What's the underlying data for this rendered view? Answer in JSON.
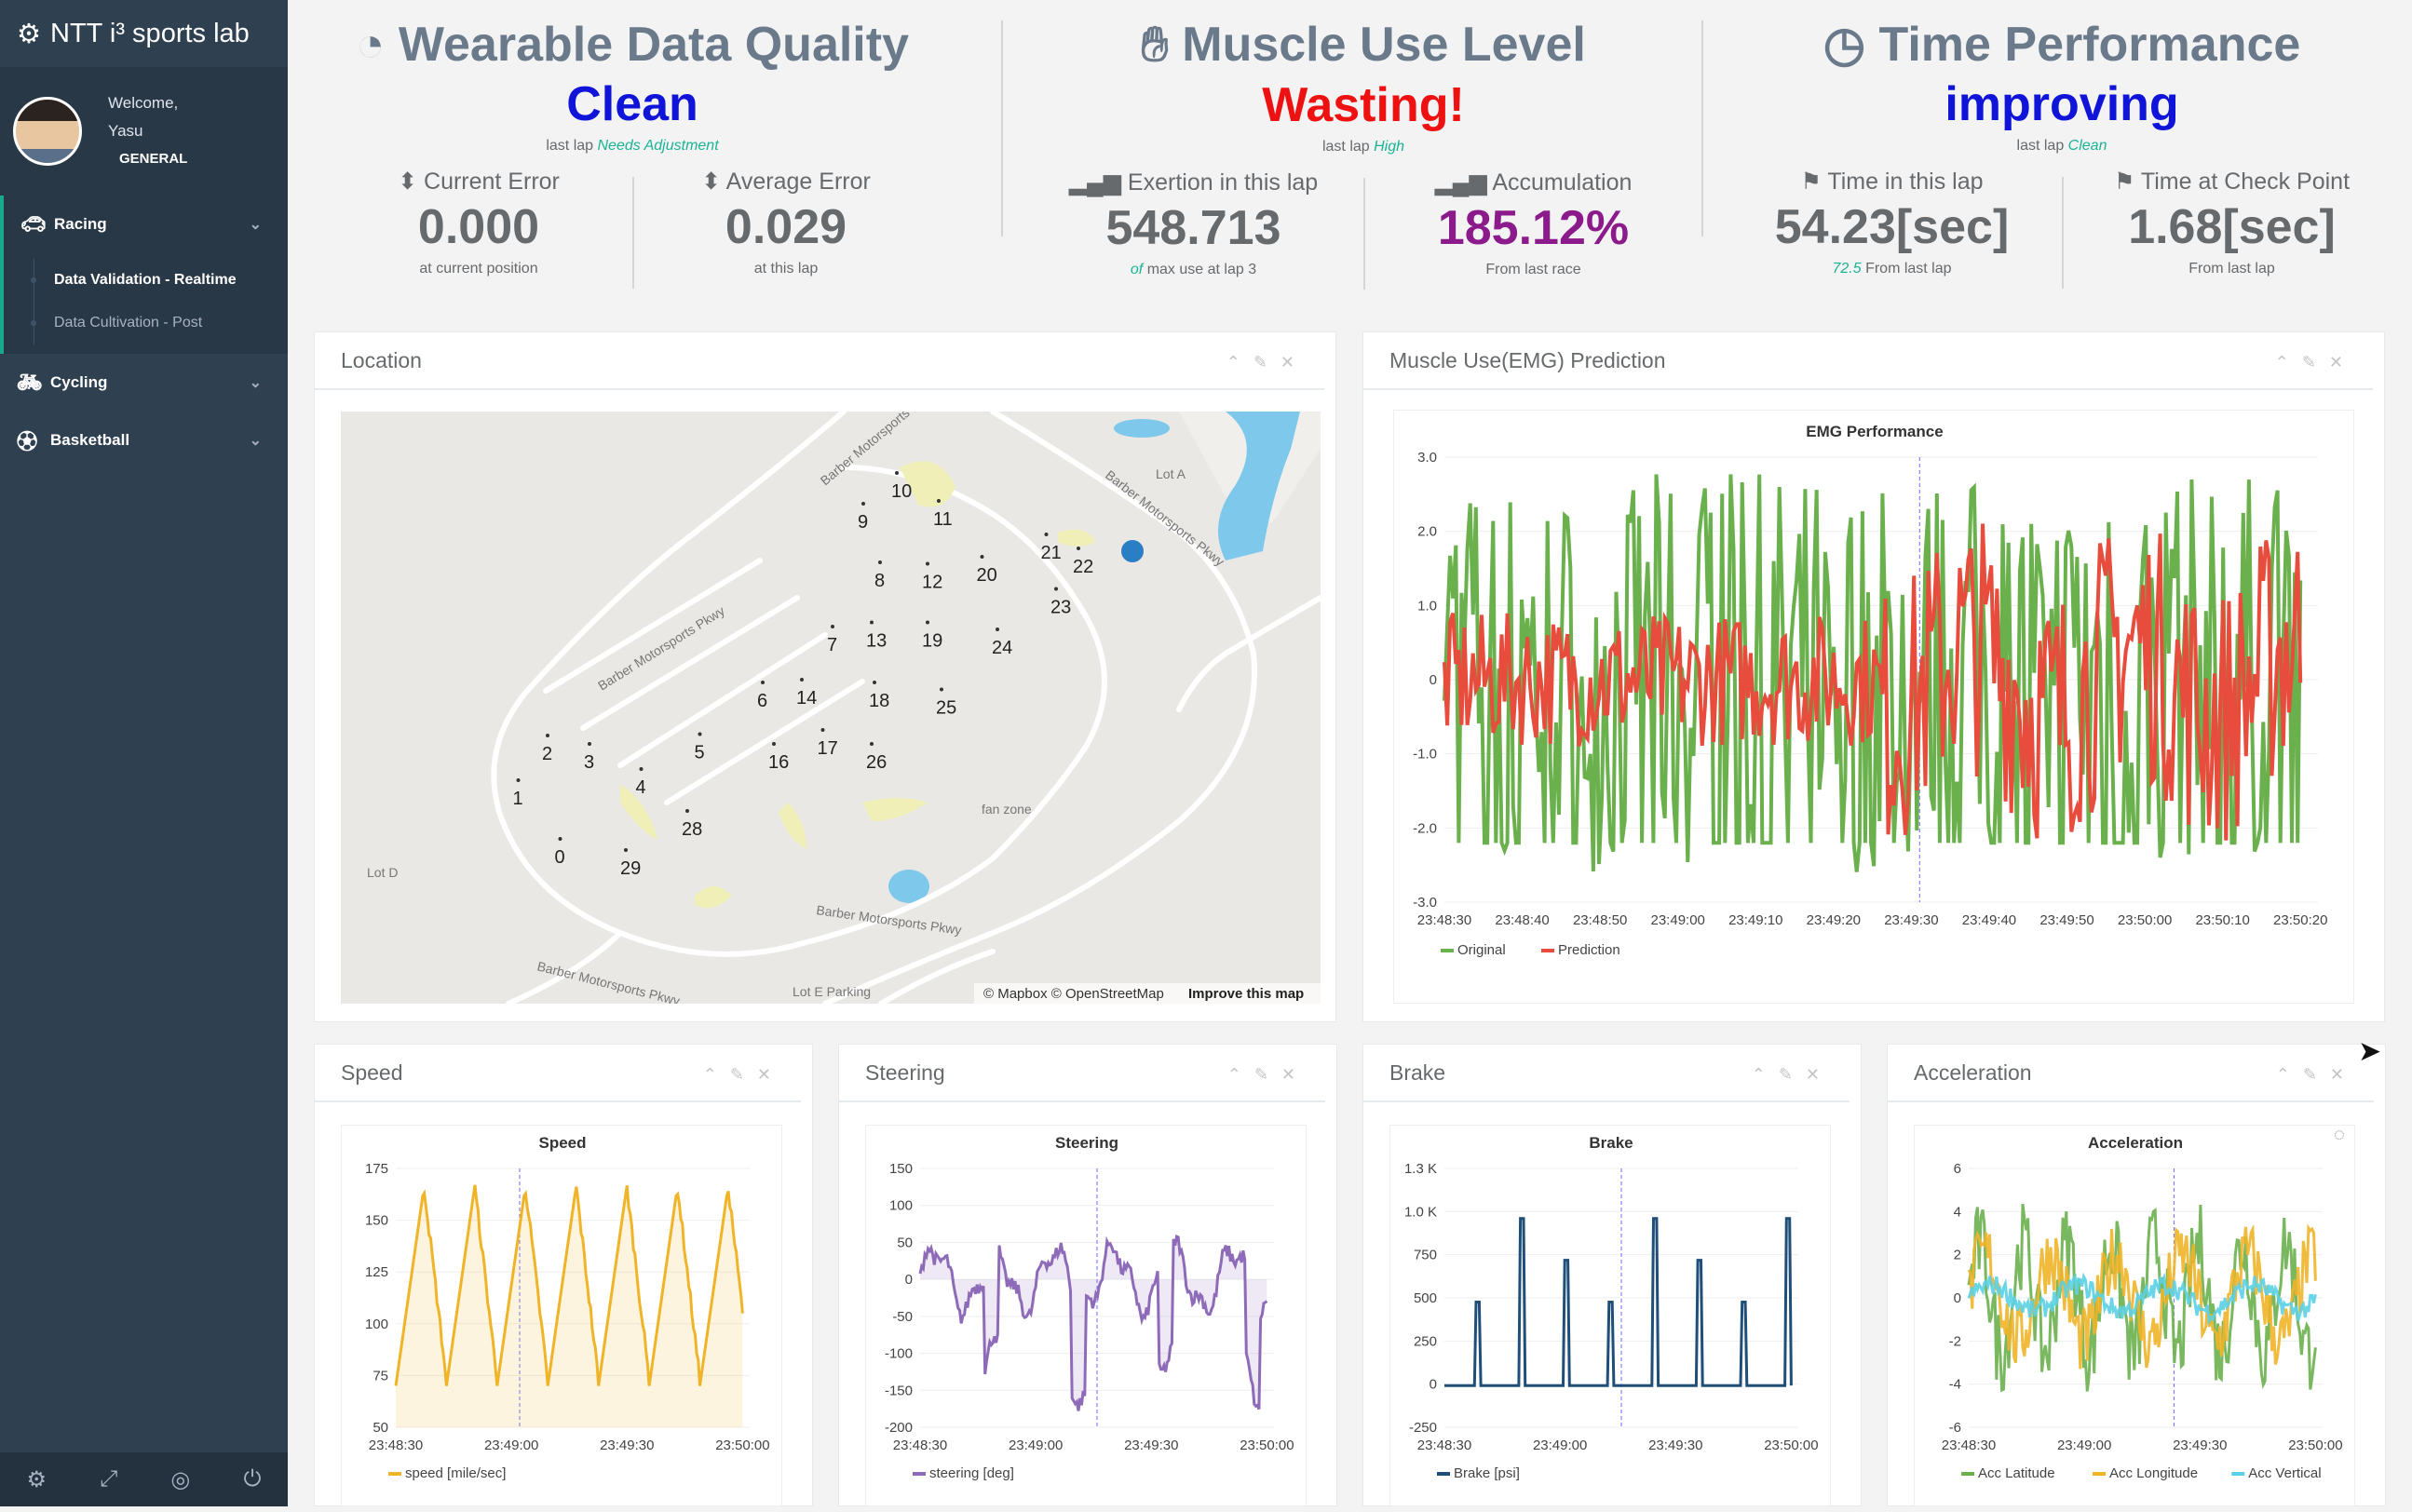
{
  "brand": {
    "title": "NTT i³ sports lab"
  },
  "profile": {
    "welcome": "Welcome,",
    "name": "Yasu",
    "role": "GENERAL"
  },
  "nav": {
    "racing": "Racing",
    "cycling": "Cycling",
    "basketball": "Basketball",
    "sub": [
      "Data Validation - Realtime",
      "Data Cultivation - Post"
    ]
  },
  "kpis": {
    "quality": {
      "title": "Wearable Data Quality",
      "status": "Clean",
      "status_color": "#1014d8",
      "sub_prefix": "last lap",
      "sub_value": "Needs Adjustment",
      "m1": {
        "label": "Current Error",
        "value": "0.000",
        "note": "at current position"
      },
      "m2": {
        "label": "Average Error",
        "value": "0.029",
        "note": "at this lap"
      }
    },
    "muscle": {
      "title": "Muscle Use Level",
      "status": "Wasting!",
      "status_color": "#ee1111",
      "sub_prefix": "last lap",
      "sub_value": "High",
      "m1": {
        "label": "Exertion in this lap",
        "value": "548.713",
        "note_em": "of",
        "note": "max use at lap 3"
      },
      "m2": {
        "label": "Accumulation",
        "value": "185.12%",
        "value_color": "#8b1a8b",
        "note": "From last race"
      }
    },
    "time": {
      "title": "Time Performance",
      "status": "improving",
      "status_color": "#1014d8",
      "sub_prefix": "last lap",
      "sub_value": "Clean",
      "m1": {
        "label": "Time in this lap",
        "value": "54.23[sec]",
        "note_em": "72.5",
        "note": "From last lap"
      },
      "m2": {
        "label": "Time at Check Point",
        "value": "1.68[sec]",
        "note": "From last lap"
      }
    }
  },
  "panels": {
    "location": "Location",
    "emg": "Muscle Use(EMG) Prediction",
    "speed": "Speed",
    "steering": "Steering",
    "brake": "Brake",
    "accel": "Acceleration"
  },
  "map": {
    "roads": [
      "Barber Motorsports Pkwy",
      "Barber Motorsports Pkwy",
      "Barber Motorsports Pkwy",
      "Barber Motorsports Pkwy",
      "Barber Motorsports Pkwy"
    ],
    "places": [
      "Lot A",
      "Lot D",
      "Lot E Parking",
      "fan zone"
    ],
    "markers": [
      "0",
      "1",
      "2",
      "3",
      "4",
      "5",
      "6",
      "7",
      "8",
      "9",
      "10",
      "11",
      "12",
      "13",
      "14",
      "16",
      "17",
      "18",
      "19",
      "20",
      "21",
      "22",
      "23",
      "24",
      "25",
      "26",
      "28",
      "29"
    ],
    "attribution": "© Mapbox © OpenStreetMap",
    "improve": "Improve this map"
  },
  "chart_data": [
    {
      "type": "line",
      "title": "EMG Performance",
      "ylim": [
        -3,
        3
      ],
      "yticks": [
        "3.0",
        "2.0",
        "1.0",
        "0",
        "-1.0",
        "-2.0",
        "-3.0"
      ],
      "xticks": [
        "23:48:30",
        "23:48:40",
        "23:48:50",
        "23:49:00",
        "23:49:10",
        "23:49:20",
        "23:49:30",
        "23:49:40",
        "23:49:50",
        "23:50:00",
        "23:50:10",
        "23:50:20"
      ],
      "series": [
        {
          "name": "Original",
          "color": "#6ab04c"
        },
        {
          "name": "Prediction",
          "color": "#e74c3c"
        }
      ]
    },
    {
      "type": "area",
      "title": "Speed",
      "ylim": [
        50,
        175
      ],
      "yticks": [
        "175",
        "150",
        "125",
        "100",
        "75",
        "50"
      ],
      "xticks": [
        "23:48:30",
        "23:49:00",
        "23:49:30",
        "23:50:00"
      ],
      "series": [
        {
          "name": "speed [mile/sec]",
          "color": "#f0b429"
        }
      ]
    },
    {
      "type": "area",
      "title": "Steering",
      "ylim": [
        -200,
        150
      ],
      "yticks": [
        "150",
        "100",
        "50",
        "0",
        "-50",
        "-100",
        "-150",
        "-200"
      ],
      "xticks": [
        "23:48:30",
        "23:49:00",
        "23:49:30",
        "23:50:00"
      ],
      "series": [
        {
          "name": "steering [deg]",
          "color": "#8e6bb8"
        }
      ]
    },
    {
      "type": "line",
      "title": "Brake",
      "ylim": [
        -250,
        1300
      ],
      "yticks": [
        "1.3 K",
        "1.0 K",
        "750",
        "500",
        "250",
        "0",
        "-250"
      ],
      "xticks": [
        "23:48:30",
        "23:49:00",
        "23:49:30",
        "23:50:00"
      ],
      "series": [
        {
          "name": "Brake [psi]",
          "color": "#1f4e79"
        }
      ]
    },
    {
      "type": "line",
      "title": "Acceleration",
      "ylim": [
        -6,
        6
      ],
      "yticks": [
        "6",
        "4",
        "2",
        "0",
        "-2",
        "-4",
        "-6"
      ],
      "xticks": [
        "23:48:30",
        "23:49:00",
        "23:49:30",
        "23:50:00"
      ],
      "series": [
        {
          "name": "Acc Latitude",
          "color": "#6ab04c"
        },
        {
          "name": "Acc Longitude",
          "color": "#f0b429"
        },
        {
          "name": "Acc Vertical",
          "color": "#5bd0e6"
        }
      ]
    }
  ]
}
